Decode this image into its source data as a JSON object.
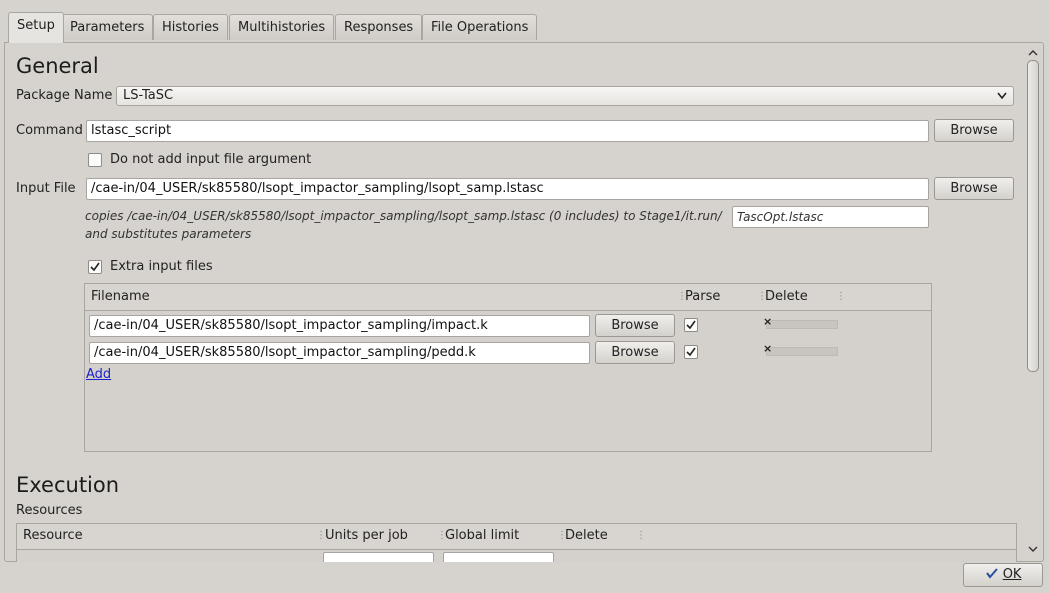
{
  "tabs": [
    {
      "label": "Setup"
    },
    {
      "label": "Parameters"
    },
    {
      "label": "Histories"
    },
    {
      "label": "Multihistories"
    },
    {
      "label": "Responses"
    },
    {
      "label": "File Operations"
    }
  ],
  "general": {
    "heading": "General",
    "package_label": "Package Name",
    "package_value": "LS-TaSC",
    "command_label": "Command",
    "command_value": "lstasc_script",
    "browse_label": "Browse",
    "no_input_arg_label": "Do not add input file argument",
    "input_file_label": "Input File",
    "input_file_value": "/cae-in/04_USER/sk85580/lsopt_impactor_sampling/lsopt_samp.lstasc",
    "copies_text": "copies /cae-in/04_USER/sk85580/lsopt_impactor_sampling/lsopt_samp.lstasc (0 includes) to Stage1/it.run/",
    "copies_target": "TascOpt.lstasc",
    "substitutes_text": "and substitutes parameters",
    "extra_files_label": "Extra input files",
    "extra_files_checked": true
  },
  "extra_table": {
    "headers": {
      "filename": "Filename",
      "parse": "Parse",
      "delete": "Delete"
    },
    "rows": [
      {
        "filename": "/cae-in/04_USER/sk85580/lsopt_impactor_sampling/impact.k",
        "browse": "Browse",
        "parse": true,
        "delete_mark": "×"
      },
      {
        "filename": "/cae-in/04_USER/sk85580/lsopt_impactor_sampling/pedd.k",
        "browse": "Browse",
        "parse": true,
        "delete_mark": "×"
      }
    ],
    "add_label": "Add"
  },
  "execution": {
    "heading": "Execution",
    "resources_label": "Resources",
    "headers": {
      "resource": "Resource",
      "units": "Units per job",
      "global": "Global limit",
      "delete": "Delete"
    }
  },
  "footer": {
    "ok_label": "OK"
  },
  "icons": {
    "check": "check-icon",
    "dropdown": "chevron-down-icon",
    "scroll_up": "chevron-up-icon",
    "scroll_down": "chevron-down-icon"
  },
  "colors": {
    "background": "#d6d3ce",
    "link": "#1a22cc"
  }
}
